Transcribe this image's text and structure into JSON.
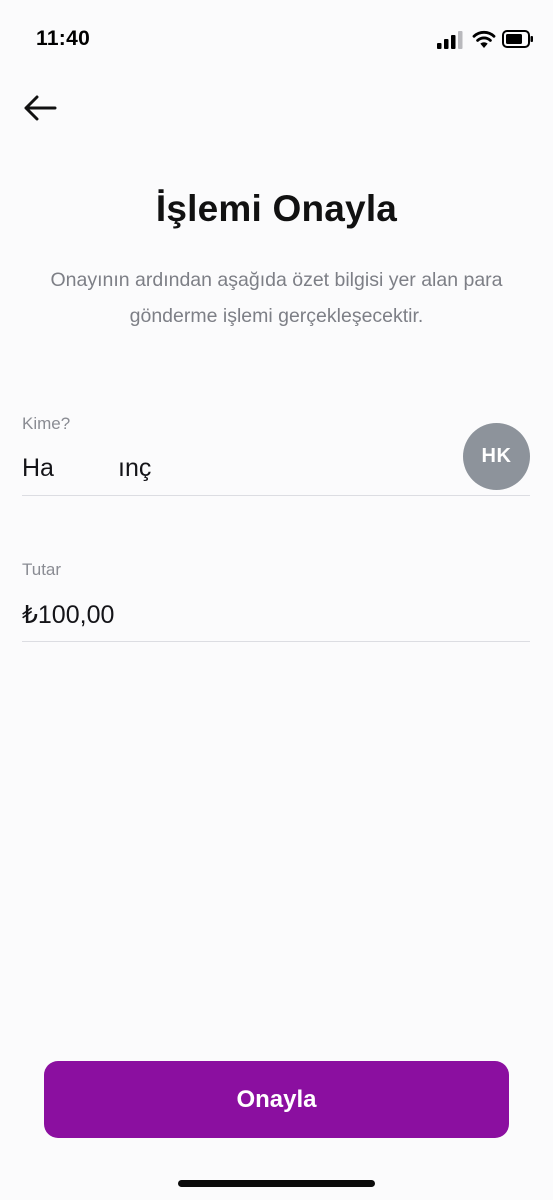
{
  "status_bar": {
    "time": "11:40"
  },
  "icons": {
    "back": "arrow-left-icon",
    "signal": "cellular-signal-icon",
    "wifi": "wifi-icon",
    "battery": "battery-icon"
  },
  "header": {
    "title": "İşlemi Onayla",
    "subtitle": "Onayının ardından aşağıda özet bilgisi yer alan para gönderme işlemi gerçekleşecektir."
  },
  "recipient": {
    "label": "Kime?",
    "name_part1": "Ha",
    "name_part2": "ınç",
    "avatar_initials": "HK"
  },
  "amount": {
    "label": "Tutar",
    "value": "₺100,00"
  },
  "actions": {
    "confirm_label": "Onayla"
  },
  "colors": {
    "primary": "#8b0fa0",
    "avatar_bg": "#8d939b",
    "background": "#fbfbfc"
  }
}
